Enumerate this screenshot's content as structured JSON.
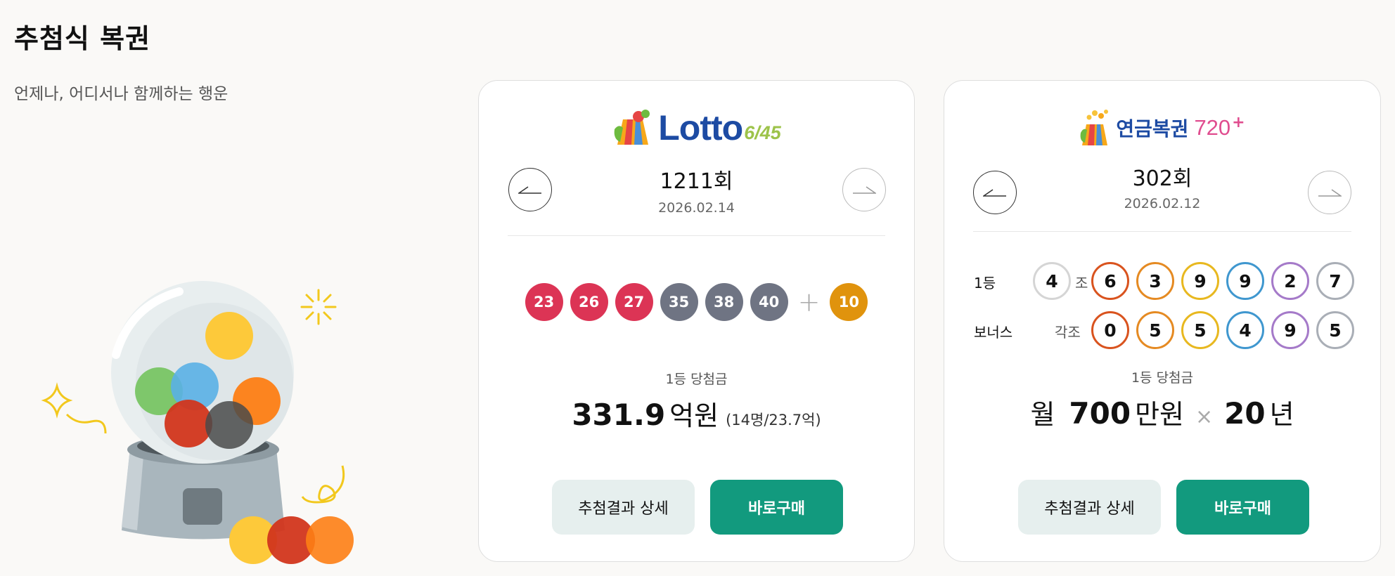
{
  "page": {
    "title": "추첨식 복권",
    "subtitle": "언제나, 어디서나 함께하는 행운"
  },
  "lotto": {
    "logo_main": "Lotto",
    "logo_sub": "6/45",
    "round": "1211회",
    "date": "2026.02.14",
    "numbers": [
      {
        "value": "23",
        "color": "#dc3455"
      },
      {
        "value": "26",
        "color": "#dc3455"
      },
      {
        "value": "27",
        "color": "#dc3455"
      },
      {
        "value": "35",
        "color": "#6f7483"
      },
      {
        "value": "38",
        "color": "#6f7483"
      },
      {
        "value": "40",
        "color": "#6f7483"
      }
    ],
    "plus": "+",
    "bonus": {
      "value": "10",
      "color": "#e0930d"
    },
    "prize_label": "1등 당첨금",
    "prize_amount": "331.9",
    "prize_unit": "억원",
    "prize_note": "(14명/23.7억)",
    "detail_button": "추첨결과 상세",
    "buy_button": "바로구매"
  },
  "pension": {
    "logo_main": "연금복권",
    "logo_sub": "720",
    "logo_plus": "+",
    "round": "302회",
    "date": "2026.02.12",
    "first": {
      "label": "1등",
      "group": "4",
      "group_suffix": "조",
      "digits": [
        {
          "value": "6",
          "color": "#d9531e"
        },
        {
          "value": "3",
          "color": "#e58a22"
        },
        {
          "value": "9",
          "color": "#e8b81f"
        },
        {
          "value": "9",
          "color": "#3f97cf"
        },
        {
          "value": "2",
          "color": "#a57ac9"
        },
        {
          "value": "7",
          "color": "#a9aeb6"
        }
      ]
    },
    "bonus": {
      "label": "보너스",
      "group_suffix": "각조",
      "digits": [
        {
          "value": "0",
          "color": "#d9531e"
        },
        {
          "value": "5",
          "color": "#e58a22"
        },
        {
          "value": "5",
          "color": "#e8b81f"
        },
        {
          "value": "4",
          "color": "#3f97cf"
        },
        {
          "value": "9",
          "color": "#a57ac9"
        },
        {
          "value": "5",
          "color": "#a9aeb6"
        }
      ]
    },
    "prize_label": "1등 당첨금",
    "prize_prefix": "월",
    "prize_amount": "700",
    "prize_unit": "만원",
    "times": "×",
    "prize_years": "20",
    "prize_years_unit": "년",
    "detail_button": "추첨결과 상세",
    "buy_button": "바로구매"
  },
  "colors": {
    "accent": "#129a7e",
    "soft": "#e6efee"
  }
}
